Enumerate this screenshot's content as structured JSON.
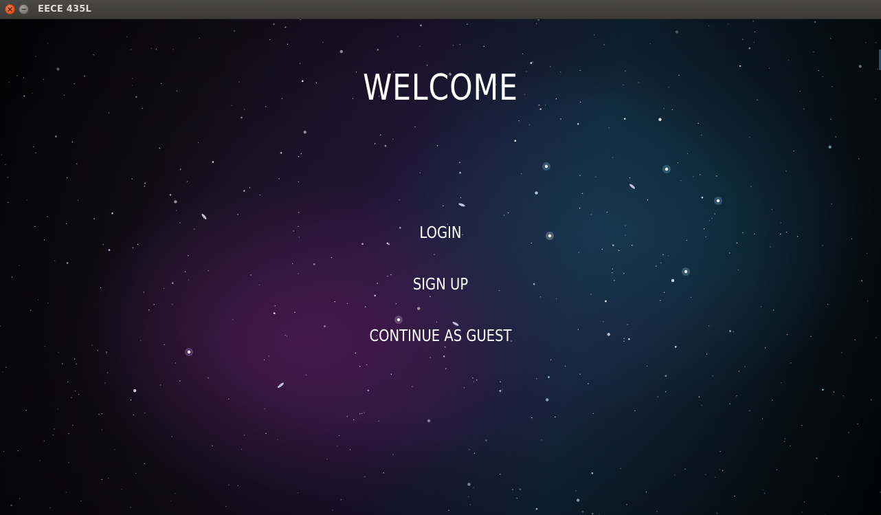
{
  "window": {
    "title": "EECE 435L",
    "close_icon": "close-icon",
    "minimize_icon": "minimize-icon"
  },
  "screen": {
    "heading": "WELCOME",
    "buttons": {
      "login": "LOGIN",
      "sign_up": "SIGN UP",
      "guest": "CONTINUE AS GUEST"
    }
  },
  "colors": {
    "titlebar": "#3c3b37",
    "close_button": "#e2521d",
    "text": "#ffffff",
    "background_teal": "#102638",
    "background_purple": "#5a1c5c"
  }
}
